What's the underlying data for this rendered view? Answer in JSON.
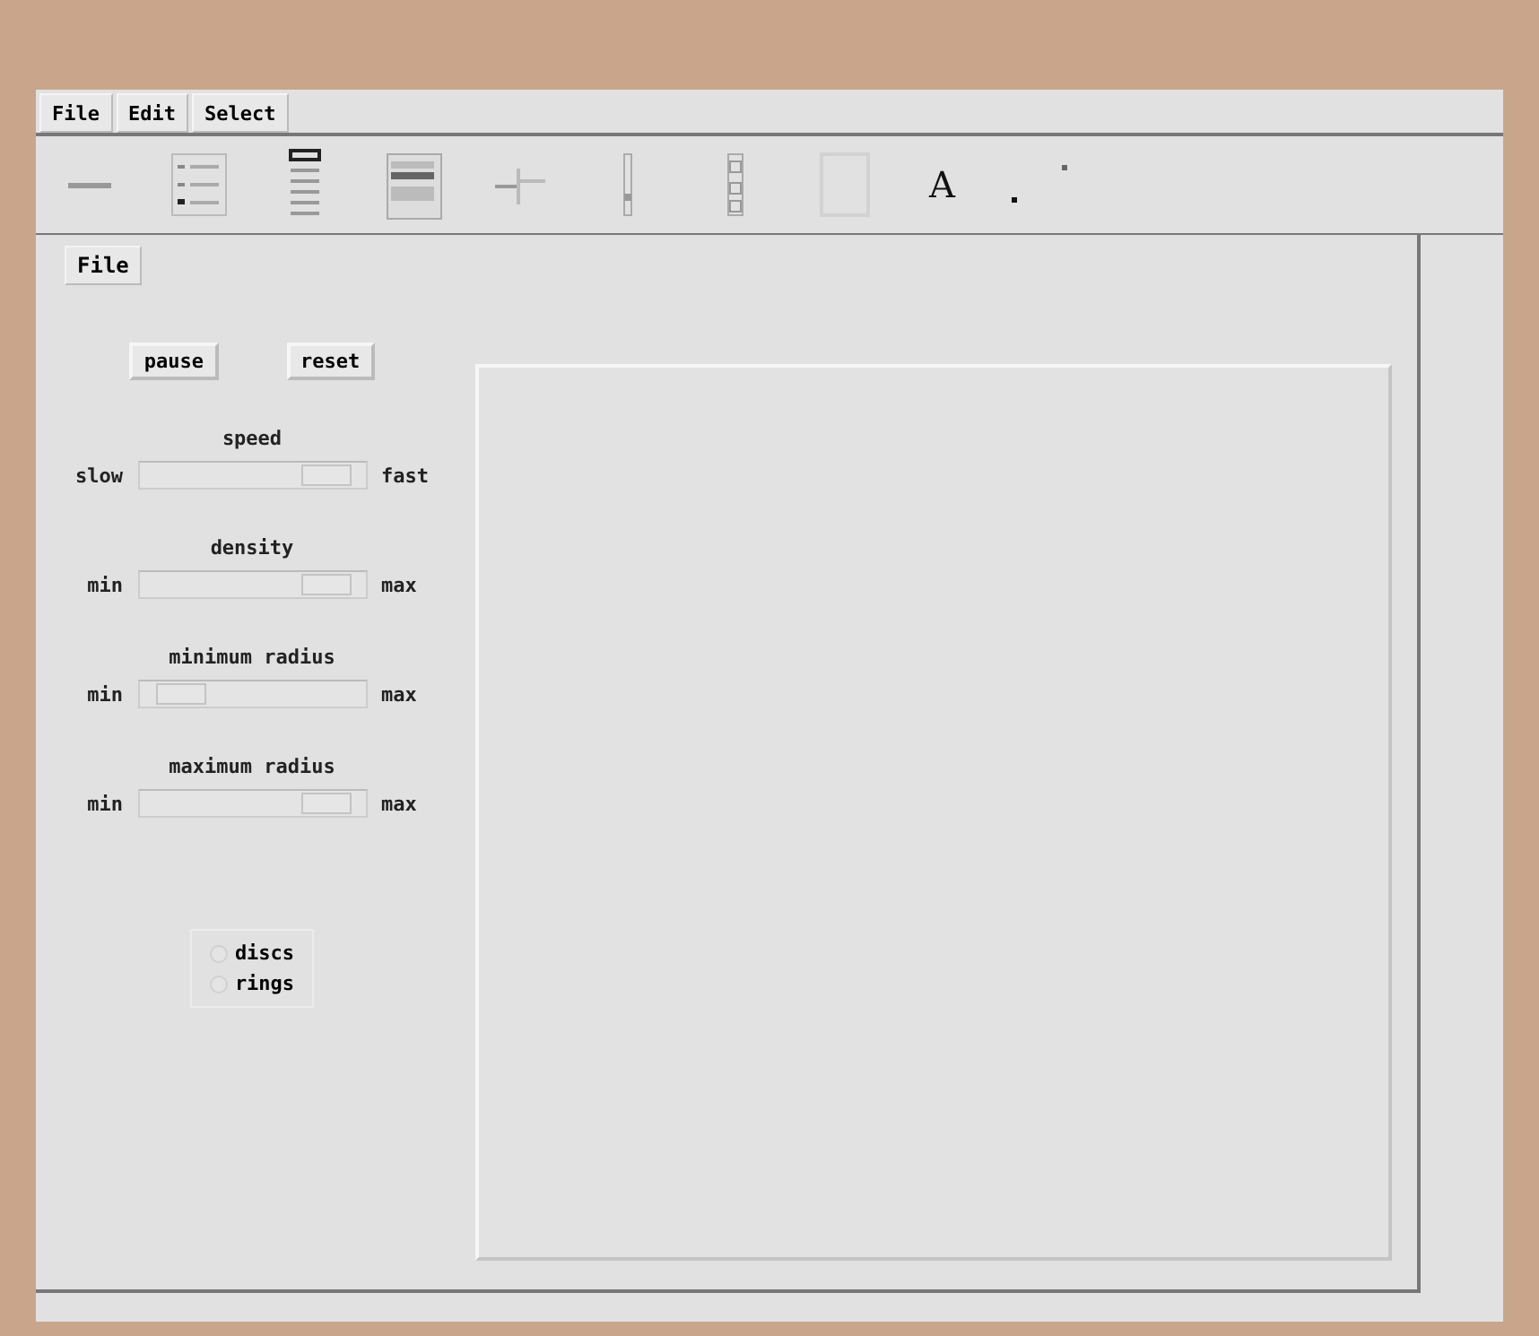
{
  "menu_bar": [
    {
      "label": "File"
    },
    {
      "label": "Edit"
    },
    {
      "label": "Select"
    }
  ],
  "toolbar": {
    "text_tool": "A"
  },
  "panel_menu": {
    "label": "File"
  },
  "buttons": [
    {
      "label": "pause"
    },
    {
      "label": "reset"
    }
  ],
  "sliders": [
    {
      "title": "speed",
      "min_label": "slow",
      "max_label": "fast",
      "level": 0.92
    },
    {
      "title": "density",
      "min_label": "min",
      "max_label": "max",
      "level": 0.92
    },
    {
      "title": "minimum radius",
      "min_label": "min",
      "max_label": "max",
      "level": 0.1
    },
    {
      "title": "maximum radius",
      "min_label": "min",
      "max_label": "max",
      "level": 0.92
    }
  ],
  "shape_options": [
    {
      "label": "discs",
      "selected": false
    },
    {
      "label": "rings",
      "selected": false
    }
  ]
}
